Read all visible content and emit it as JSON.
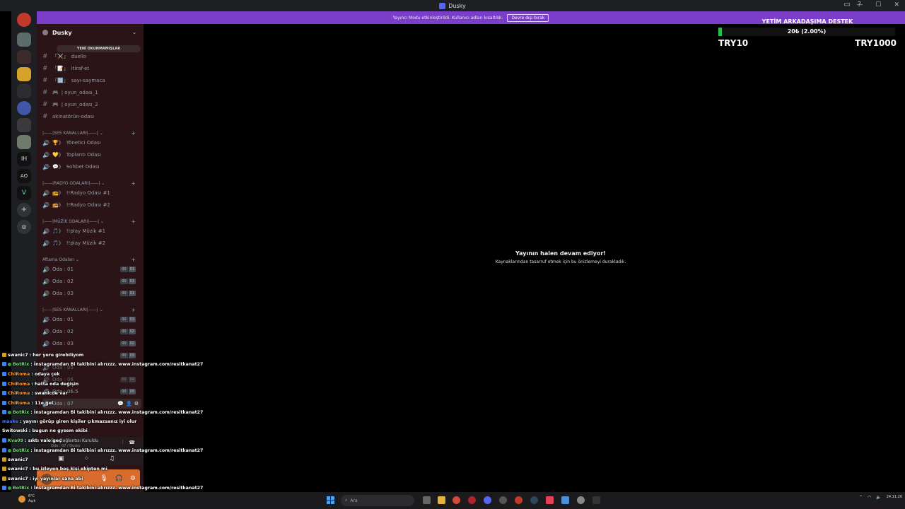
{
  "window": {
    "title": "Dusky",
    "controls": [
      "—",
      "☐",
      "✕"
    ]
  },
  "banner": {
    "text": "Yayıncı Modu etkinleştirildi. Kullanıcı adları kısaltıldı.",
    "button": "Devre dışı bırak"
  },
  "sidebar": {
    "guild_name": "Dusky",
    "unread_pill": "YENİ OKUNMAMIŞLAR",
    "text_channels": [
      {
        "prefix": "「⚔️」",
        "name": "duello"
      },
      {
        "prefix": "「📝」",
        "name": "itiraf-et"
      },
      {
        "prefix": "「🔢」",
        "name": "sayı-saymaca"
      },
      {
        "prefix": "🎮",
        "name": "| oyun_odası_1"
      },
      {
        "prefix": "🎮",
        "name": "| oyun_odası_2"
      },
      {
        "prefix": "",
        "name": "akinatörün-odası"
      }
    ],
    "cat_voice": "|——|SES KANALLARI|——|",
    "voice_channels": [
      {
        "prefix": "🏆》",
        "name": "Yönetici Odası"
      },
      {
        "prefix": "💛》",
        "name": "Toplantı Odası"
      },
      {
        "prefix": "💬》",
        "name": "Sohbet Odası"
      }
    ],
    "cat_radio": "|——|RADYO ODALARI|——|",
    "radio_channels": [
      {
        "prefix": "📻》",
        "name": "!!Radyo Odası #1"
      },
      {
        "prefix": "📻》",
        "name": "!!Radyo Odası #2"
      }
    ],
    "cat_music": "|——|MÜZİK ODALARI|——|",
    "music_channels": [
      {
        "prefix": "🎵》",
        "name": "!!play Müzik #1"
      },
      {
        "prefix": "🎵》",
        "name": "!!play Müzik #2"
      }
    ],
    "cat_aftama": "Aftama Odaları",
    "aftama_rooms": [
      {
        "name": "Oda : 01",
        "a": "00",
        "b": "01"
      },
      {
        "name": "Oda : 02",
        "a": "00",
        "b": "01"
      },
      {
        "name": "Oda : 03",
        "a": "00",
        "b": "01"
      }
    ],
    "cat_voice2": "|——|SES KANALLARI|——|",
    "voice2_rooms": [
      {
        "name": "Oda : 01",
        "a": "00",
        "b": "03"
      },
      {
        "name": "Oda : 02",
        "a": "00",
        "b": "02"
      },
      {
        "name": "Oda : 03",
        "a": "00",
        "b": "02"
      }
    ],
    "partial_rooms": [
      {
        "name": "",
        "a": "00",
        "b": "03"
      },
      {
        "name": "Oda : 05",
        "a": "",
        "b": ""
      },
      {
        "name": "Oda : 06",
        "a": "00",
        "b": "04"
      },
      {
        "name": "Oda : 06.5",
        "a": "00",
        "b": "05"
      },
      {
        "name": "Oda : 07",
        "a": "",
        "b": ""
      }
    ]
  },
  "main": {
    "paused_title": "Yayının halen devam ediyor!",
    "paused_sub": "Kaynaklarından tasarruf etmek için bu önizlemeyi durakladık."
  },
  "donation": {
    "title": "YETİM ARKADAŞIMA DESTEK",
    "progress_text": "20₺ (2.00%)",
    "progress_percent": 2,
    "min_label": "TRY10",
    "max_label": "TRY1000",
    "fill_color": "#23c24a"
  },
  "chat": [
    {
      "platform": "kick",
      "user": "swanic7",
      "color": "#ffffff",
      "text": ": her yere girebiliyom",
      "badge": false
    },
    {
      "platform": "tw",
      "user": "BotRix",
      "color": "#6fe06f",
      "text": ": İnstagramdan Bi takibini alırızzz. www.instagram.com/resitkanat27",
      "badge": true
    },
    {
      "platform": "tw",
      "user": "ChiRoma",
      "color": "#ff9e3d",
      "text": ": odaya çek",
      "badge": false
    },
    {
      "platform": "tw",
      "user": "ChiRoma",
      "color": "#ff9e3d",
      "text": ": hatta oda değişin",
      "badge": false
    },
    {
      "platform": "tw",
      "user": "ChiRoma",
      "color": "#ff9e3d",
      "text": ": swanicde var",
      "badge": false
    },
    {
      "platform": "tw",
      "user": "ChiRoma",
      "color": "#ff9e3d",
      "text": ": 11e gel",
      "badge": false
    },
    {
      "platform": "tw",
      "user": "BotRix",
      "color": "#6fe06f",
      "text": ": İnstagramdan Bi takibini alırızzz. www.instagram.com/resitkanat27",
      "badge": true
    },
    {
      "platform": "",
      "user": "maske",
      "color": "#4f7bff",
      "text": ": yayını görüp giren kişiler çıkmazsanız iyi olur",
      "badge": false
    },
    {
      "platform": "",
      "user": "Switowski",
      "color": "#ffffff",
      "text": ": bugun ne gysem ekibi",
      "badge": false
    },
    {
      "platform": "tw",
      "user": "Kva09",
      "color": "#6fe06f",
      "text": ": sıktı valo geç",
      "badge": false
    },
    {
      "platform": "tw",
      "user": "BotRix",
      "color": "#6fe06f",
      "text": ": İnstagramdan Bi takibini alırızzz. www.instagram.com/resitkanat27",
      "badge": true
    },
    {
      "platform": "kick",
      "user": "swanic7",
      "color": "#ffffff",
      "text": "",
      "badge": false
    },
    {
      "platform": "kick",
      "user": "swanic7",
      "color": "#ffffff",
      "text": ": bu izleyen beş kişi ekipten mi",
      "badge": false
    },
    {
      "platform": "kick",
      "user": "swanic7",
      "color": "#ffffff",
      "text": ": iyi yayınlar sana abi",
      "badge": false
    },
    {
      "platform": "tw",
      "user": "BotRix",
      "color": "#6fe06f",
      "text": ": İnstagramdan Bi takibini alırızzz. www.instagram.com/resitkanat27",
      "badge": true
    }
  ],
  "voice_panel": {
    "status": "Ses Bağlantısı Kuruldu",
    "sub": "Oda : 07 / Dusky"
  },
  "taskbar": {
    "weather_temp": "6°C",
    "weather_desc": "Açık",
    "search_placeholder": "Ara",
    "time": "",
    "date": "24.11.20"
  }
}
